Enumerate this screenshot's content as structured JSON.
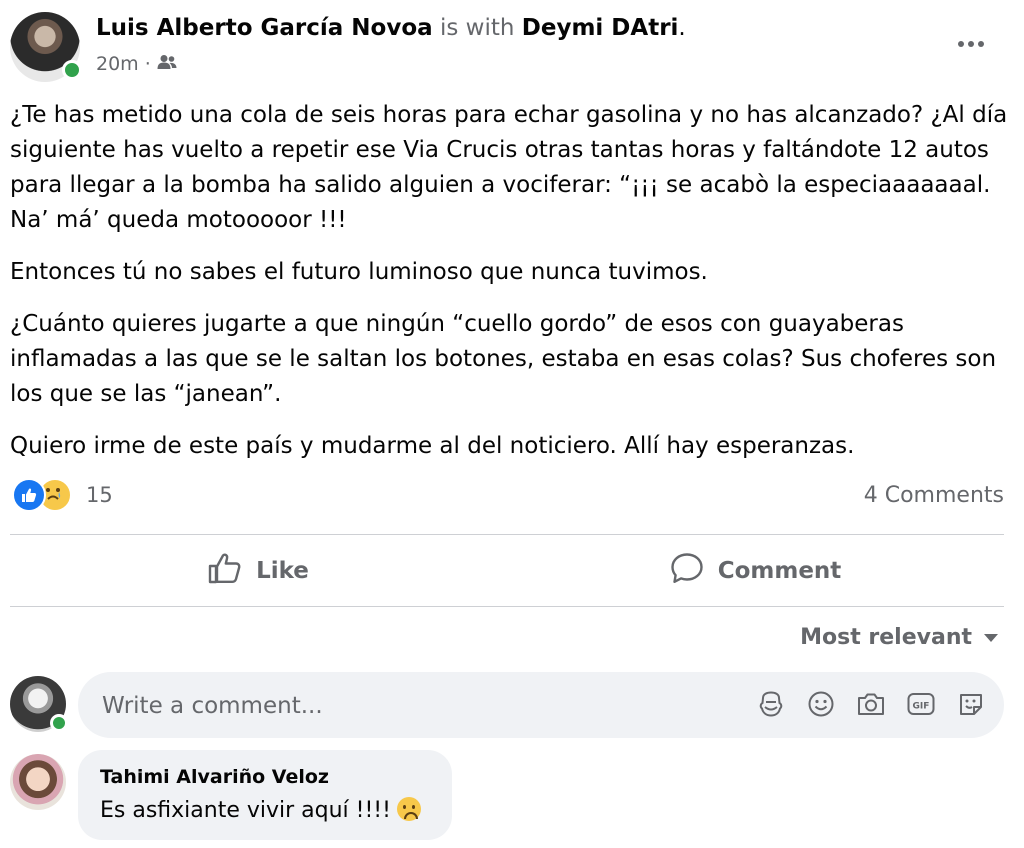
{
  "post": {
    "author": "Luis Alberto García Novoa",
    "with_text": "is with",
    "tagged": "Deymi DAtri",
    "tagged_suffix": ".",
    "time": "20m",
    "separator": "·",
    "audience_icon": "friends-icon",
    "paragraphs": [
      "¿Te has metido una cola de seis horas para echar gasolina y no has alcanzado? ¿Al día siguiente has vuelto a repetir ese Via Crucis otras tantas horas y faltándote 12 autos para llegar a la bomba ha salido alguien a vociferar: “¡¡¡ se acabò la especiaaaaaaal. Na’ má’ queda motooooor !!!",
      "Entonces tú no sabes el futuro luminoso que nunca tuvimos.",
      "¿Cuánto quieres jugarte a que ningún “cuello gordo” de esos con guayaberas inflamadas a las que se le saltan los botones, estaba en esas colas? Sus choferes son los que se las “janean”.",
      "Quiero irme de este país y mudarme al del noticiero. Allí hay esperanzas."
    ]
  },
  "reactions": {
    "types": [
      "like-icon",
      "sad-icon"
    ],
    "count": "15",
    "comments": "4 Comments"
  },
  "actions": {
    "like_label": "Like",
    "comment_label": "Comment"
  },
  "sort": {
    "label": "Most relevant"
  },
  "composer": {
    "placeholder": "Write a comment...",
    "icons": [
      "avatar-sticker-icon",
      "emoji-icon",
      "camera-icon",
      "gif-icon",
      "sticker-icon"
    ]
  },
  "comment": {
    "author": "Tahimi Alvariño Veloz",
    "text": "Es asfixiante vivir aquí !!!!"
  },
  "colors": {
    "accent": "#1877f2",
    "secondary_text": "#65676b",
    "bubble": "#f0f2f5",
    "online": "#31a24c"
  }
}
